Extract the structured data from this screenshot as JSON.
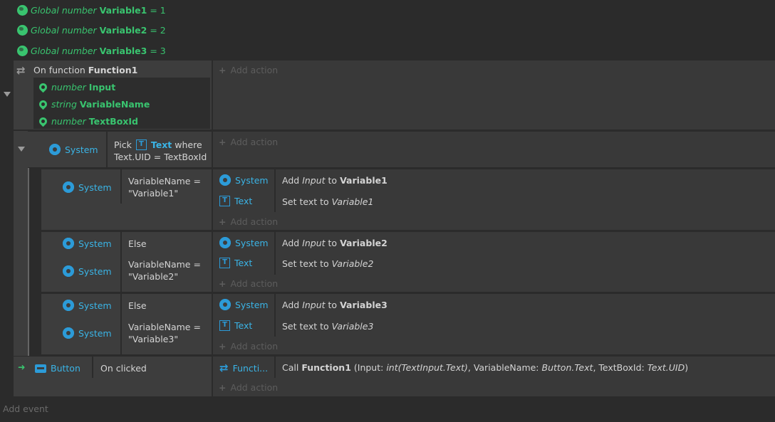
{
  "globals": [
    {
      "kind": "Global number",
      "name": "Variable1",
      "op": "= 1"
    },
    {
      "kind": "Global number",
      "name": "Variable2",
      "op": "= 2"
    },
    {
      "kind": "Global number",
      "name": "Variable3",
      "op": "= 3"
    }
  ],
  "function_event": {
    "prefix": "On function",
    "name": "Function1",
    "params": [
      {
        "type": "number",
        "name": "Input"
      },
      {
        "type": "string",
        "name": "VariableName"
      },
      {
        "type": "number",
        "name": "TextBoxId"
      }
    ],
    "add_action": "Add action"
  },
  "pick_event": {
    "object": "System",
    "cond_pick": "Pick",
    "cond_obj": "Text",
    "cond_where": "where",
    "cond_line2": "Text.UID = TextBoxId",
    "add_action": "Add action"
  },
  "sub1": {
    "conds": [
      {
        "object": "System",
        "text": "VariableName = \"Variable1\""
      }
    ],
    "actions": [
      {
        "object": "System",
        "pre": "Add ",
        "it": "Input",
        "mid": " to ",
        "b": "Variable1"
      },
      {
        "object": "Text",
        "pre": "Set text to ",
        "it": "Variable1"
      }
    ],
    "add_action": "Add action"
  },
  "sub2": {
    "conds": [
      {
        "object": "System",
        "text": "Else"
      },
      {
        "object": "System",
        "text": "VariableName = \"Variable2\""
      }
    ],
    "actions": [
      {
        "object": "System",
        "pre": "Add ",
        "it": "Input",
        "mid": " to ",
        "b": "Variable2"
      },
      {
        "object": "Text",
        "pre": "Set text to ",
        "it": "Variable2"
      }
    ],
    "add_action": "Add action"
  },
  "sub3": {
    "conds": [
      {
        "object": "System",
        "text": "Else"
      },
      {
        "object": "System",
        "text": "VariableName = \"Variable3\""
      }
    ],
    "actions": [
      {
        "object": "System",
        "pre": "Add ",
        "it": "Input",
        "mid": " to ",
        "b": "Variable3"
      },
      {
        "object": "Text",
        "pre": "Set text to ",
        "it": "Variable3"
      }
    ],
    "add_action": "Add action"
  },
  "button_event": {
    "object": "Button",
    "condition": "On clicked",
    "action_object": "Functi...",
    "call": "Call",
    "fn": "Function1",
    "args_1": " (Input: ",
    "args_1i": "int(TextInput.Text)",
    "args_2": ", VariableName: ",
    "args_2i": "Button.Text",
    "args_3": ", TextBoxId: ",
    "args_3i": "Text.UID",
    "args_end": ")",
    "add_action": "Add action"
  },
  "add_event": "Add event",
  "colors": {
    "green": "#39c46f",
    "blue": "#3ab4e6",
    "bg": "#2b2b2b",
    "panel": "#3d3d3d"
  }
}
